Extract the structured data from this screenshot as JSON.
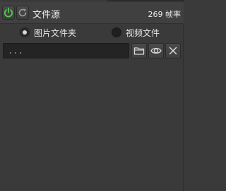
{
  "header": {
    "title": "文件源",
    "fps_value": "269",
    "fps_unit": "帧率",
    "power_state": "on",
    "accent": "#5cc45a"
  },
  "source_type": {
    "options": [
      {
        "label": "图片文件夹",
        "selected": true
      },
      {
        "label": "视频文件",
        "selected": false
      }
    ]
  },
  "path": {
    "value": "...",
    "placeholder": ""
  },
  "icons": {
    "power": "power-icon",
    "reload": "reload-icon",
    "browse": "folder-icon",
    "preview": "eye-icon",
    "clear": "close-icon"
  }
}
